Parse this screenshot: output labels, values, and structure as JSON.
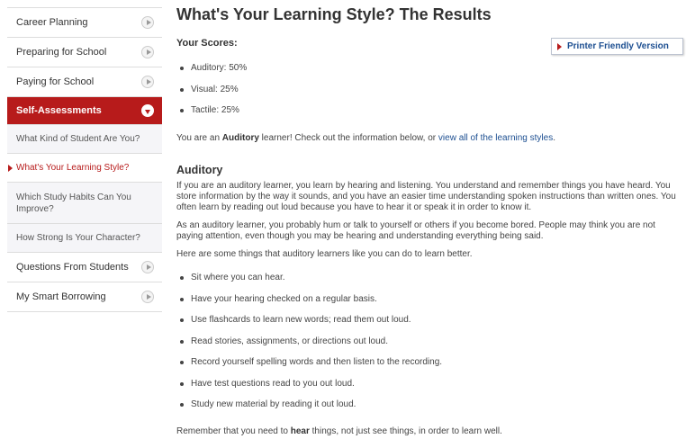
{
  "sidebar": {
    "items_top": [
      {
        "label": "Career Planning"
      },
      {
        "label": "Preparing for School"
      },
      {
        "label": "Paying for School"
      }
    ],
    "active": {
      "label": "Self-Assessments"
    },
    "sub_items": [
      {
        "label": "What Kind of Student Are You?"
      },
      {
        "label": "What's Your Learning Style?"
      },
      {
        "label": "Which Study Habits Can You Improve?"
      },
      {
        "label": "How Strong Is Your Character?"
      }
    ],
    "items_bottom": [
      {
        "label": "Questions From Students"
      },
      {
        "label": "My Smart Borrowing"
      }
    ]
  },
  "main": {
    "title": "What's Your Learning Style? The Results",
    "scores_label": "Your Scores:",
    "print_button": "Printer Friendly Version",
    "scores": [
      "Auditory: 50%",
      "Visual: 25%",
      "Tactile: 25%"
    ],
    "result_prefix": "You are an ",
    "result_style": "Auditory",
    "result_middle": " learner! Check out the information below, or ",
    "result_link": "view all of the learning styles",
    "result_suffix": ".",
    "section_title": "Auditory",
    "para1": "If you are an auditory learner, you learn by hearing and listening. You understand and remember things you have heard. You store information by the way it sounds, and you have an easier time understanding spoken instructions than written ones. You often learn by reading out loud because you have to hear it or speak it in order to know it.",
    "para2": "As an auditory learner, you probably hum or talk to yourself or others if you become bored. People may think you are not paying attention, even though you may be hearing and understanding everything being said.",
    "para3": "Here are some things that auditory learners like you can do to learn better.",
    "tips": [
      "Sit where you can hear.",
      "Have your hearing checked on a regular basis.",
      "Use flashcards to learn new words; read them out loud.",
      "Read stories, assignments, or directions out loud.",
      "Record yourself spelling words and then listen to the recording.",
      "Have test questions read to you out loud.",
      "Study new material by reading it out loud."
    ],
    "closing_prefix": "Remember that you need to ",
    "closing_bold": "hear",
    "closing_suffix": " things, not just see things, in order to learn well."
  }
}
